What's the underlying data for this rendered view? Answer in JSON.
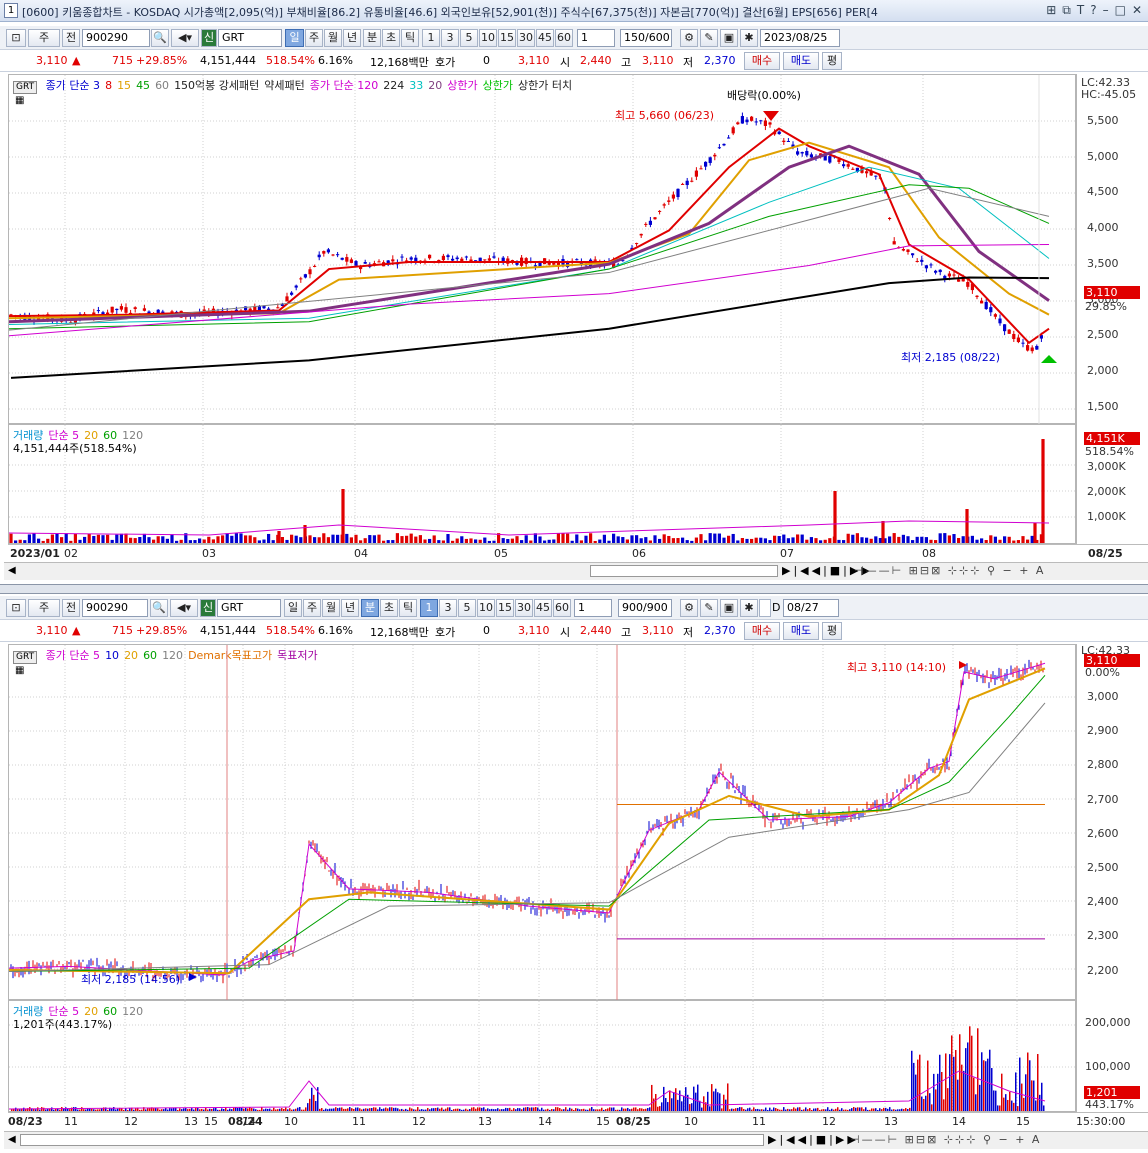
{
  "window": {
    "number": "1",
    "title": "[0600] 키움종합차트 - KOSDAQ 시가총액[2,095(억)] 부채비율[86.2] 유통비율[46.6] 외국인보유[52,901(천)] 주식수[67,375(천)] 자본금[770(억)] 결산[6월] EPS[656] PER[4"
  },
  "top": {
    "toolbar": {
      "type1": "주",
      "type2": "전",
      "code": "900290",
      "new_badge": "신",
      "name": "GRT",
      "periods": [
        "일",
        "주",
        "월",
        "년",
        "분",
        "초",
        "틱"
      ],
      "selected_period": "일",
      "nums": [
        "1",
        "3",
        "5",
        "10",
        "15",
        "30",
        "45",
        "60"
      ],
      "mult": "1",
      "count": "150/600",
      "date": "2023/08/25"
    },
    "quote": {
      "price": "3,110",
      "arrow": "▲",
      "change": "715",
      "rate": "+29.85%",
      "volume": "4,151,444",
      "vol_rate": "518.54%",
      "turnover": "6.16%",
      "amount": "12,168백만",
      "hoga_label": "호가",
      "hoga": "0",
      "cur": "3,110",
      "open_label": "시",
      "open": "2,440",
      "high_label": "고",
      "high": "3,110",
      "low_label": "저",
      "low": "2,370",
      "buy": "매수",
      "sell": "매도",
      "avg": "평"
    },
    "legend": {
      "tag": "GRT",
      "items": [
        {
          "t": "종가 단순 3",
          "c": "#0000d0"
        },
        {
          "t": "8",
          "c": "#e00000"
        },
        {
          "t": "15",
          "c": "#e0a000"
        },
        {
          "t": "45",
          "c": "#00a000"
        },
        {
          "t": "60",
          "c": "#808080"
        },
        {
          "t": "150억봉 강세패턴",
          "c": "#222"
        },
        {
          "t": "약세패턴",
          "c": "#222"
        },
        {
          "t": "종가 단순 120",
          "c": "#d000d0"
        },
        {
          "t": "224",
          "c": "#222"
        },
        {
          "t": "33",
          "c": "#00c0c0"
        },
        {
          "t": "20",
          "c": "#804080"
        },
        {
          "t": "상한가",
          "c": "#d000d0"
        },
        {
          "t": "상한가",
          "c": "#00c000"
        },
        {
          "t": "상한가 터치",
          "c": "#222"
        }
      ]
    },
    "annotations": {
      "high": "최고 5,660 (06/23)",
      "div": "배당락(0.00%)",
      "low": "최저 2,185 (08/22)",
      "lc": "LC:42.33",
      "hc": "HC:-45.05",
      "price_tag": "3,110",
      "price_pct": "29.85%"
    },
    "yticks": [
      "5,500",
      "5,000",
      "4,500",
      "4,000",
      "3,500",
      "3,000",
      "2,500",
      "2,000",
      "1,500"
    ],
    "vol_legend": {
      "items": [
        {
          "t": "거래량",
          "c": "#0090d0"
        },
        {
          "t": "단순 5",
          "c": "#d000d0"
        },
        {
          "t": "20",
          "c": "#e0a000"
        },
        {
          "t": "60",
          "c": "#00a000"
        },
        {
          "t": "120",
          "c": "#808080"
        }
      ],
      "value": "4,151,444주(518.54%)",
      "tag": "4,151K",
      "tag_pct": "518.54%"
    },
    "vol_ticks": [
      "3,000K",
      "2,000K",
      "1,000K"
    ],
    "xlabels": [
      "2023/01",
      "02",
      "03",
      "04",
      "05",
      "06",
      "07",
      "08",
      "08/25"
    ]
  },
  "bottom": {
    "toolbar": {
      "type1": "주",
      "type2": "전",
      "code": "900290",
      "new_badge": "신",
      "name": "GRT",
      "periods": [
        "일",
        "주",
        "월",
        "년",
        "분",
        "초",
        "틱"
      ],
      "selected_period": "분",
      "nums": [
        "1",
        "3",
        "5",
        "10",
        "15",
        "30",
        "45",
        "60"
      ],
      "selected_num": "1",
      "mult": "1",
      "count": "900/900",
      "d": "D",
      "date": "08/27"
    },
    "quote": {
      "price": "3,110",
      "arrow": "▲",
      "change": "715",
      "rate": "+29.85%",
      "volume": "4,151,444",
      "vol_rate": "518.54%",
      "turnover": "6.16%",
      "amount": "12,168백만",
      "hoga_label": "호가",
      "hoga": "0",
      "cur": "3,110",
      "open_label": "시",
      "open": "2,440",
      "high_label": "고",
      "high": "3,110",
      "low_label": "저",
      "low": "2,370",
      "buy": "매수",
      "sell": "매도",
      "avg": "평"
    },
    "legend": {
      "tag": "GRT",
      "items": [
        {
          "t": "종가 단순 5",
          "c": "#d000d0"
        },
        {
          "t": "10",
          "c": "#0000d0"
        },
        {
          "t": "20",
          "c": "#e0a000"
        },
        {
          "t": "60",
          "c": "#00a000"
        },
        {
          "t": "120",
          "c": "#808080"
        },
        {
          "t": "Demark목표고가",
          "c": "#e07000"
        },
        {
          "t": "목표저가",
          "c": "#a000a0"
        }
      ]
    },
    "annotations": {
      "high": "최고 3,110 (14:10)",
      "low": "최저 2,185 (14:56)",
      "lc": "LC:42.33",
      "hc": "HC:-45.05",
      "price_tag": "3,110",
      "price_pct": "0.00%"
    },
    "yticks": [
      "3,000",
      "2,900",
      "2,800",
      "2,700",
      "2,600",
      "2,500",
      "2,400",
      "2,300",
      "2,200"
    ],
    "vol_legend": {
      "items": [
        {
          "t": "거래량",
          "c": "#0090d0"
        },
        {
          "t": "단순 5",
          "c": "#d000d0"
        },
        {
          "t": "20",
          "c": "#e0a000"
        },
        {
          "t": "60",
          "c": "#00a000"
        },
        {
          "t": "120",
          "c": "#808080"
        }
      ],
      "value": "1,201주(443.17%)",
      "tag": "1,201",
      "tag_pct": "443.17%"
    },
    "vol_ticks": [
      "200,000",
      "100,000"
    ],
    "xlabels": [
      "08/23",
      "11",
      "12",
      "13",
      "14",
      "15",
      "08/24",
      "10",
      "11",
      "12",
      "13",
      "14",
      "15",
      "08/25",
      "10",
      "11",
      "12",
      "13",
      "14",
      "15",
      "15:30:00"
    ]
  }
}
